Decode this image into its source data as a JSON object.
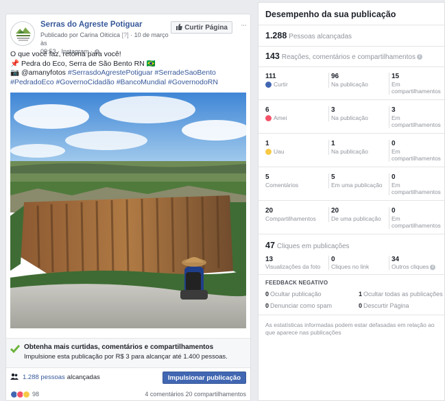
{
  "post": {
    "page_name": "Serras do Agreste Potiguar",
    "published_by": "Publicado por Carina Oiticica",
    "published_tag": "[?]",
    "date": "10 de março às",
    "time_source": "09:53 · Instagram · ",
    "like_page_label": "Curtir Página",
    "more_label": "···",
    "text_line1": "O que você faz, retorna para você!",
    "text_line2": "📌 Pedra do Eco, Serra de São Bento RN 🇧🇷",
    "text_line3_prefix": "📷 @amanyfotos ",
    "text_line3_tags": "#SerrasdoAgrestePotiguar #SerradeSaoBento",
    "text_line4_tags": "#PedradoEco #GovernoCidadão #BancoMundial #GovernodoRN",
    "boost_title": "Obtenha mais curtidas, comentários e compartilhamentos",
    "boost_sub": "Impulsione esta publicação por R$ 3 para alcançar até 1.400 pessoas.",
    "reach_link": "1.288 pessoas",
    "reach_suffix": "alcançadas",
    "boost_button": "Impulsionar publicação",
    "reactions_count": "98",
    "comments_shares": "4 comentários  20 compartilhamentos",
    "colors": {
      "brand_blue": "#4267b2",
      "link": "#365899"
    }
  },
  "insights": {
    "title": "Desempenho da sua publicação",
    "reach_value": "1.288",
    "reach_label": "Pessoas alcançadas",
    "engagement_value": "143",
    "engagement_label": "Reações, comentários e compartilhamentos",
    "rows": [
      {
        "v1": "111",
        "l1": "Curtir",
        "v2": "96",
        "l2": "Na publicação",
        "v3": "15",
        "l3": "Em compartilhamentos"
      },
      {
        "v1": "6",
        "l1": "Amei",
        "v2": "3",
        "l2": "Na publicação",
        "v3": "3",
        "l3": "Em compartilhamentos"
      },
      {
        "v1": "1",
        "l1": "Uau",
        "v2": "1",
        "l2": "Na publicação",
        "v3": "0",
        "l3": "Em compartilhamentos"
      },
      {
        "v1": "5",
        "l1": "Comentários",
        "v2": "5",
        "l2": "Em uma publicação",
        "v3": "0",
        "l3": "Em compartilhamentos"
      },
      {
        "v1": "20",
        "l1": "Compartilhamentos",
        "v2": "20",
        "l2": "De uma publicação",
        "v3": "0",
        "l3": "Em compartilhamentos"
      }
    ],
    "clicks_value": "47",
    "clicks_label": "Cliques em publicações",
    "clicks": [
      {
        "v": "13",
        "l": "Visualizações da foto"
      },
      {
        "v": "0",
        "l": "Cliques no link"
      },
      {
        "v": "34",
        "l": "Outros cliques"
      }
    ],
    "negative_title": "FEEDBACK NEGATIVO",
    "negative": [
      {
        "v": "0",
        "l": "Ocultar publicação"
      },
      {
        "v": "1",
        "l": "Ocultar todas as publicações"
      },
      {
        "v": "0",
        "l": "Denunciar como spam"
      },
      {
        "v": "0",
        "l": "Descurtir Página"
      }
    ],
    "disclaimer": "As estatísticas informadas podem estar defasadas em relação ao que aparece nas publicações"
  }
}
